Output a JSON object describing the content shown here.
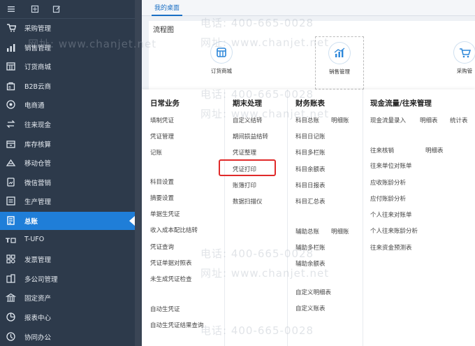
{
  "sidebar": {
    "items": [
      {
        "label": "采购管理",
        "icon": "purchase-icon"
      },
      {
        "label": "销售管理",
        "icon": "sales-chart-icon"
      },
      {
        "label": "订货商城",
        "icon": "store-icon"
      },
      {
        "label": "B2B云商",
        "icon": "b2b-bag-icon"
      },
      {
        "label": "电商通",
        "icon": "ecommerce-icon"
      },
      {
        "label": "往来现金",
        "icon": "exchange-icon"
      },
      {
        "label": "库存核算",
        "icon": "inventory-icon"
      },
      {
        "label": "移动仓管",
        "icon": "mobile-warehouse-icon"
      },
      {
        "label": "微信营销",
        "icon": "wechat-icon"
      },
      {
        "label": "生产管理",
        "icon": "production-icon"
      },
      {
        "label": "总账",
        "icon": "ledger-icon"
      },
      {
        "label": "T-UFO",
        "icon": "tufo-icon"
      },
      {
        "label": "发票管理",
        "icon": "invoice-icon"
      },
      {
        "label": "多公司管理",
        "icon": "multi-company-icon"
      },
      {
        "label": "固定资产",
        "icon": "bank-icon"
      },
      {
        "label": "报表中心",
        "icon": "report-icon"
      },
      {
        "label": "协同办公",
        "icon": "collab-icon"
      }
    ],
    "active_index": 10
  },
  "tabs": [
    {
      "label": "我的桌面"
    }
  ],
  "flow": {
    "title": "流程图",
    "nodes": [
      {
        "label": "订货商城"
      },
      {
        "label": "销售管理"
      },
      {
        "label": "采购管"
      }
    ]
  },
  "columns": {
    "daily": {
      "title": "日常业务",
      "items": [
        "填制凭证",
        "凭证管理",
        "记账",
        "科目设置",
        "摘要设置",
        "单据生凭证",
        "收入成本配比结转",
        "凭证查询",
        "凭证单据对照表",
        "未生成凭证检查",
        "自动生凭证",
        "自动生凭证结果查询"
      ]
    },
    "period_end": {
      "title": "期末处理",
      "items": [
        "自定义结转",
        "期间损益结转",
        "凭证整理",
        "凭证打印",
        "账簿打印",
        "数据扫描仪"
      ]
    },
    "books": {
      "title": "财务账表",
      "items": [
        "科目总账",
        "明细账",
        "科目日记账",
        "科目多栏账",
        "科目余额表",
        "科目日报表",
        "科目汇总表",
        "辅助总账",
        "明细账",
        "辅助多栏账",
        "辅助余额表",
        "自定义明细表",
        "自定义账表"
      ]
    },
    "cashflow": {
      "title": "现金流量/往来管理",
      "items": [
        "现金流量录入",
        "明细表",
        "统计表",
        "往来核销",
        "明细表",
        "往来单位对账单",
        "应收账龄分析",
        "应付账龄分析",
        "个人往来对账单",
        "个人往来账龄分析",
        "往来资金预测表"
      ]
    }
  },
  "watermark": {
    "phone": "电话: 400-665-0028",
    "site": "网址: www.chanjet.net"
  },
  "colors": {
    "sidebar": "#2d3a4b",
    "active": "#1f7ed8",
    "highlight": "#e02a2a",
    "accent": "#1a6fc4"
  }
}
